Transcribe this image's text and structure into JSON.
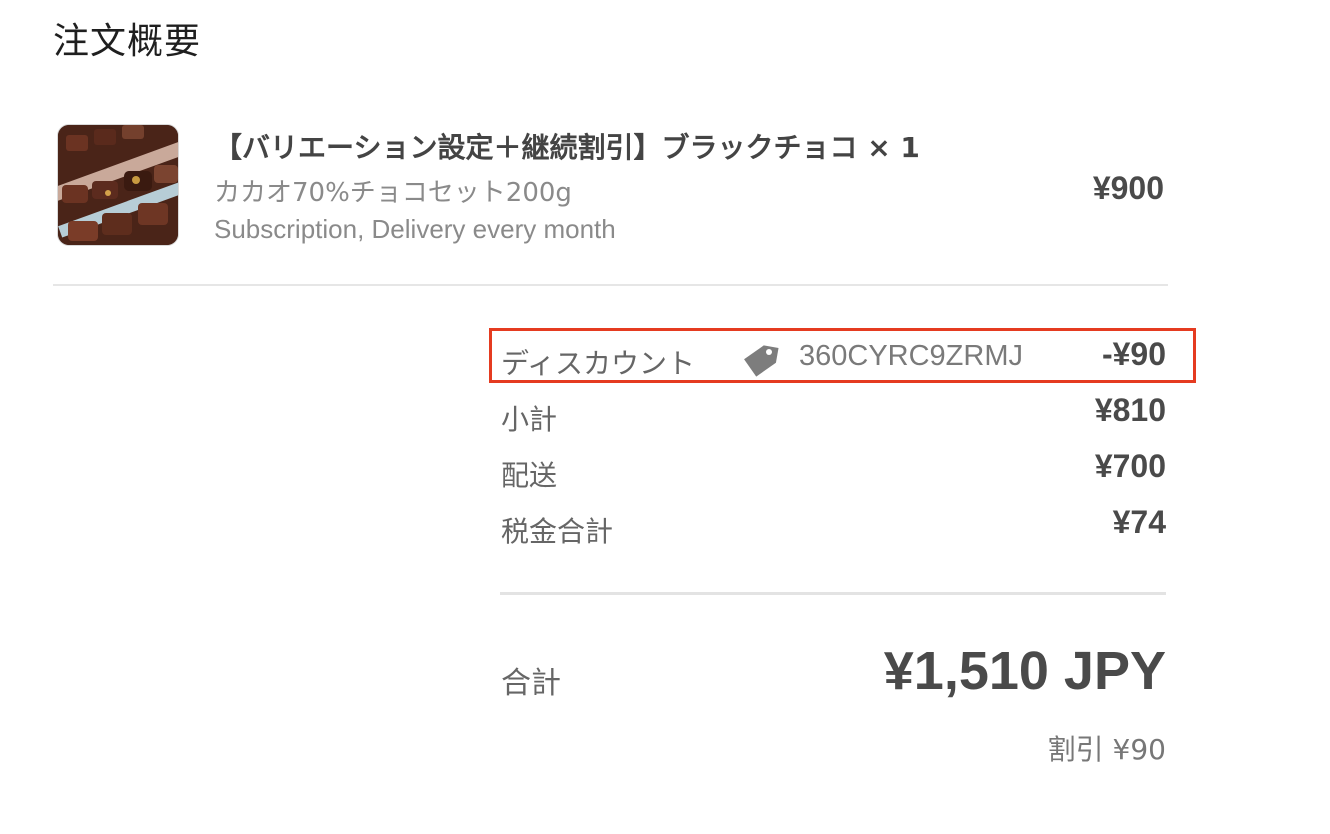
{
  "header": {
    "title": "注文概要"
  },
  "product": {
    "name": "【バリエーション設定＋継続割引】ブラックチョコ × 1",
    "variant": "カカオ70%チョコセット200g",
    "plan": "Subscription, Delivery every month",
    "price": "¥900",
    "image_icon": "chocolate-box-image"
  },
  "summary": {
    "discount": {
      "label": "ディスカウント",
      "icon": "tag-icon",
      "code": "360CYRC9ZRMJ",
      "amount": "-¥90"
    },
    "subtotal": {
      "label": "小計",
      "amount": "¥810"
    },
    "shipping": {
      "label": "配送",
      "amount": "¥700"
    },
    "tax": {
      "label": "税金合計",
      "amount": "¥74"
    }
  },
  "total": {
    "label": "合計",
    "amount": "¥1,510 JPY",
    "savings": "割引 ¥90"
  },
  "colors": {
    "highlight_border": "#e53b20",
    "text_primary": "#4a4a4a",
    "text_muted": "#8a8a8a"
  }
}
